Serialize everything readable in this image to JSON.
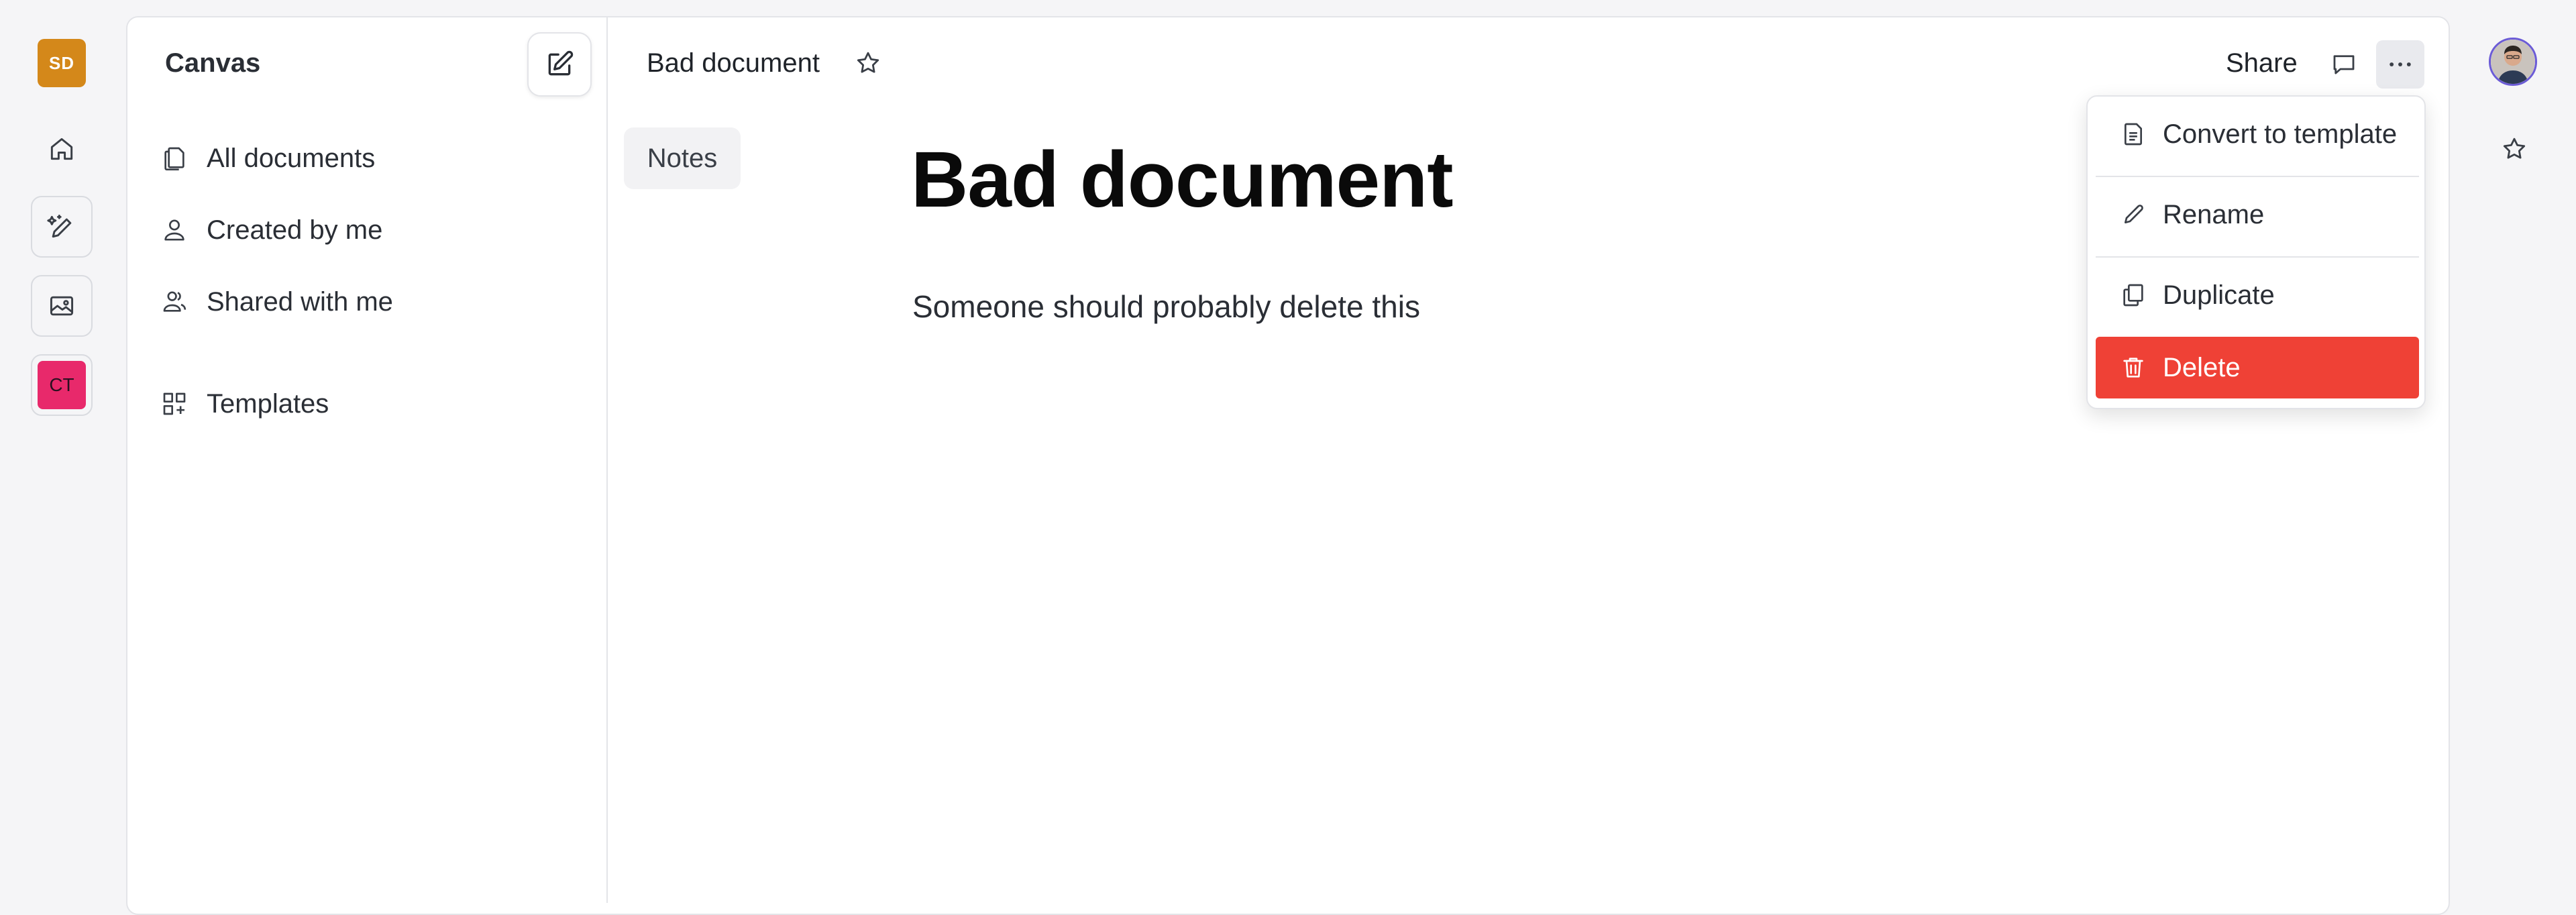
{
  "rail": {
    "user_initials": "SD",
    "workspace_initials": "CT"
  },
  "sidebar": {
    "title": "Canvas",
    "items": [
      {
        "label": "All documents",
        "icon": "documents-icon"
      },
      {
        "label": "Created by me",
        "icon": "person-icon"
      },
      {
        "label": "Shared with me",
        "icon": "people-icon"
      },
      {
        "label": "Templates",
        "icon": "templates-icon"
      }
    ]
  },
  "header": {
    "doc_title": "Bad document",
    "share_label": "Share"
  },
  "notes_tab": {
    "label": "Notes"
  },
  "document": {
    "heading": "Bad document",
    "body": "Someone should probably delete this"
  },
  "menu": {
    "items": [
      {
        "label": "Convert to template",
        "icon": "template-icon"
      },
      {
        "label": "Rename",
        "icon": "pencil-icon"
      },
      {
        "label": "Duplicate",
        "icon": "copy-icon"
      },
      {
        "label": "Delete",
        "icon": "trash-icon"
      }
    ]
  },
  "colors": {
    "user_avatar": "#d4881a",
    "workspace_avatar": "#e8296b",
    "danger": "#ef4136",
    "profile_ring": "#6b5bd6"
  }
}
